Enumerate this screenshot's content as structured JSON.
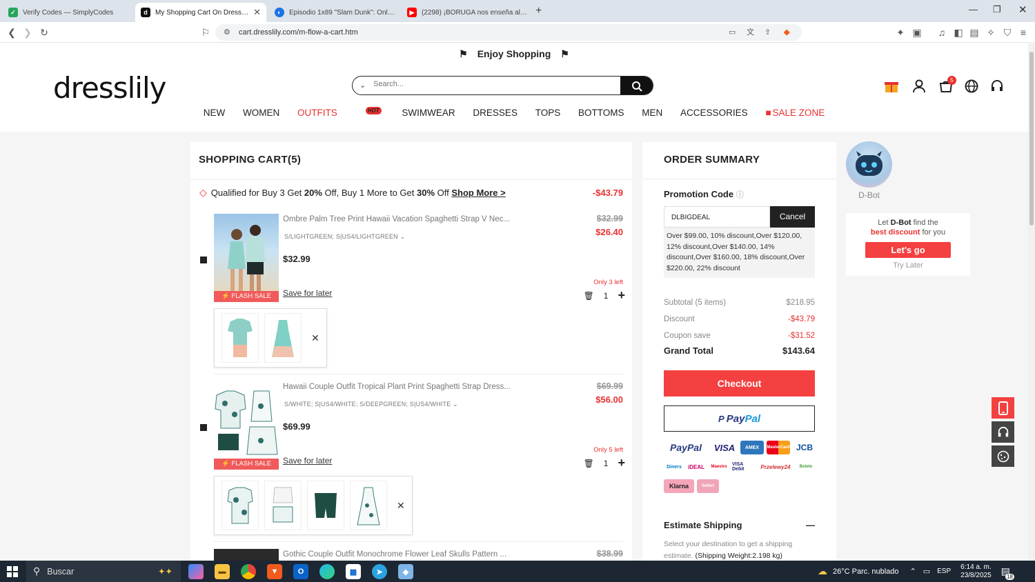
{
  "browser": {
    "tabs": [
      {
        "title": "Verify Codes — SimplyCodes",
        "active": false,
        "favicon_color": "#26a65b"
      },
      {
        "title": "My Shopping Cart On Dresslily.c",
        "active": true,
        "favicon_color": "#111111"
      },
      {
        "title": "Episodio 1x89 \"Slam Dunk\": Online H",
        "active": false,
        "favicon_color": "#1a73e8"
      },
      {
        "title": "(2298) ¡BORUGA nos enseña algunas",
        "active": false,
        "favicon_color": "#ff0000"
      }
    ],
    "url": "cart.dresslily.com/m-flow-a-cart.htm"
  },
  "header": {
    "banner": "Enjoy Shopping",
    "logo": "dresslily",
    "search_placeholder": "Search...",
    "cart_count": "5",
    "nav": [
      {
        "label": "NEW",
        "red": false
      },
      {
        "label": "WOMEN",
        "red": false
      },
      {
        "label": "OUTFITS",
        "red": true,
        "badge": "HOT"
      },
      {
        "label": "SWIMWEAR",
        "red": false
      },
      {
        "label": "DRESSES",
        "red": false
      },
      {
        "label": "TOPS",
        "red": false
      },
      {
        "label": "BOTTOMS",
        "red": false
      },
      {
        "label": "MEN",
        "red": false
      },
      {
        "label": "ACCESSORIES",
        "red": false
      },
      {
        "label": "SALE ZONE",
        "red": true
      }
    ]
  },
  "cart": {
    "title": "SHOPPING CART(5)",
    "promo": {
      "pre": "Qualified for Buy 3 Get ",
      "p1": "20%",
      "mid": " Off, Buy 1 More to Get ",
      "p2": "30%",
      "post": " Off ",
      "link": "Shop More >",
      "amount": "-$43.79"
    },
    "items": [
      {
        "title": "Ombre Palm Tree Print Hawaii Vacation Spaghetti Strap V Nec...",
        "variant": "S/LIGHTGREEN; S|US4/LIGHTGREEN",
        "price": "$32.99",
        "old_price": "$32.99",
        "new_price": "$26.40",
        "stock": "Only 3 left",
        "qty": "1",
        "flash": "FLASH SALE",
        "save": "Save for later"
      },
      {
        "title": "Hawaii Couple Outfit Tropical Plant Print Spaghetti Strap Dress...",
        "variant": "S/WHITE; S|US4/WHITE; S/DEEPGREEN; S|US4/WHITE",
        "price": "$69.99",
        "old_price": "$69.99",
        "new_price": "$56.00",
        "stock": "Only 5 left",
        "qty": "1",
        "flash": "FLASH SALE",
        "save": "Save for later"
      },
      {
        "title": "Gothic Couple Outfit Monochrome Flower Leaf Skulls Pattern ...",
        "old_price": "$38.99"
      }
    ]
  },
  "summary": {
    "title": "ORDER SUMMARY",
    "promo_label": "Promotion Code",
    "promo_code": "DLBIGDEAL",
    "cancel": "Cancel",
    "promo_msg": "Over $99.00, 10% discount,Over $120.00, 12% discount,Over $140.00, 14% discount,Over $160.00, 18% discount,Over $220.00, 22% discount",
    "rows": [
      {
        "label": "Subtotal (5 items)",
        "value": "$218.95"
      },
      {
        "label": "Discount",
        "value": "-$43.79"
      },
      {
        "label": "Coupon save",
        "value": "-$31.52"
      }
    ],
    "grand_total_label": "Grand Total",
    "grand_total": "$143.64",
    "checkout": "Checkout",
    "paypal_a": "Pay",
    "paypal_b": "Pal",
    "est_title": "Estimate Shipping",
    "est_text": "Select your destination to get a shipping estimate.",
    "est_weight": "(Shipping Weight:2.198 kg)",
    "payments": [
      "PayPal",
      "VISA",
      "AMEX",
      "MasterCard",
      "JCB",
      "Diners",
      "iDEAL",
      "Maestro",
      "VISA Debit",
      "Przelewy24",
      "Boleto",
      "Klarna",
      "Sofort"
    ]
  },
  "dbot": {
    "name": "D-Bot",
    "line1_pre": "Let ",
    "line1_bold": "D-Bot",
    "line1_post": " find the",
    "line2_red": "best discount",
    "line2_post": " for you",
    "go": "Let's go",
    "later": "Try Later"
  },
  "taskbar": {
    "search": "Buscar",
    "weather": "26°C  Parc. nublado",
    "lang": "ESP",
    "time": "6:14 a. m.",
    "date": "23/8/2025",
    "notif": "18"
  },
  "colors": {
    "accent": "#f44040",
    "sale_red": "#e8312f"
  }
}
